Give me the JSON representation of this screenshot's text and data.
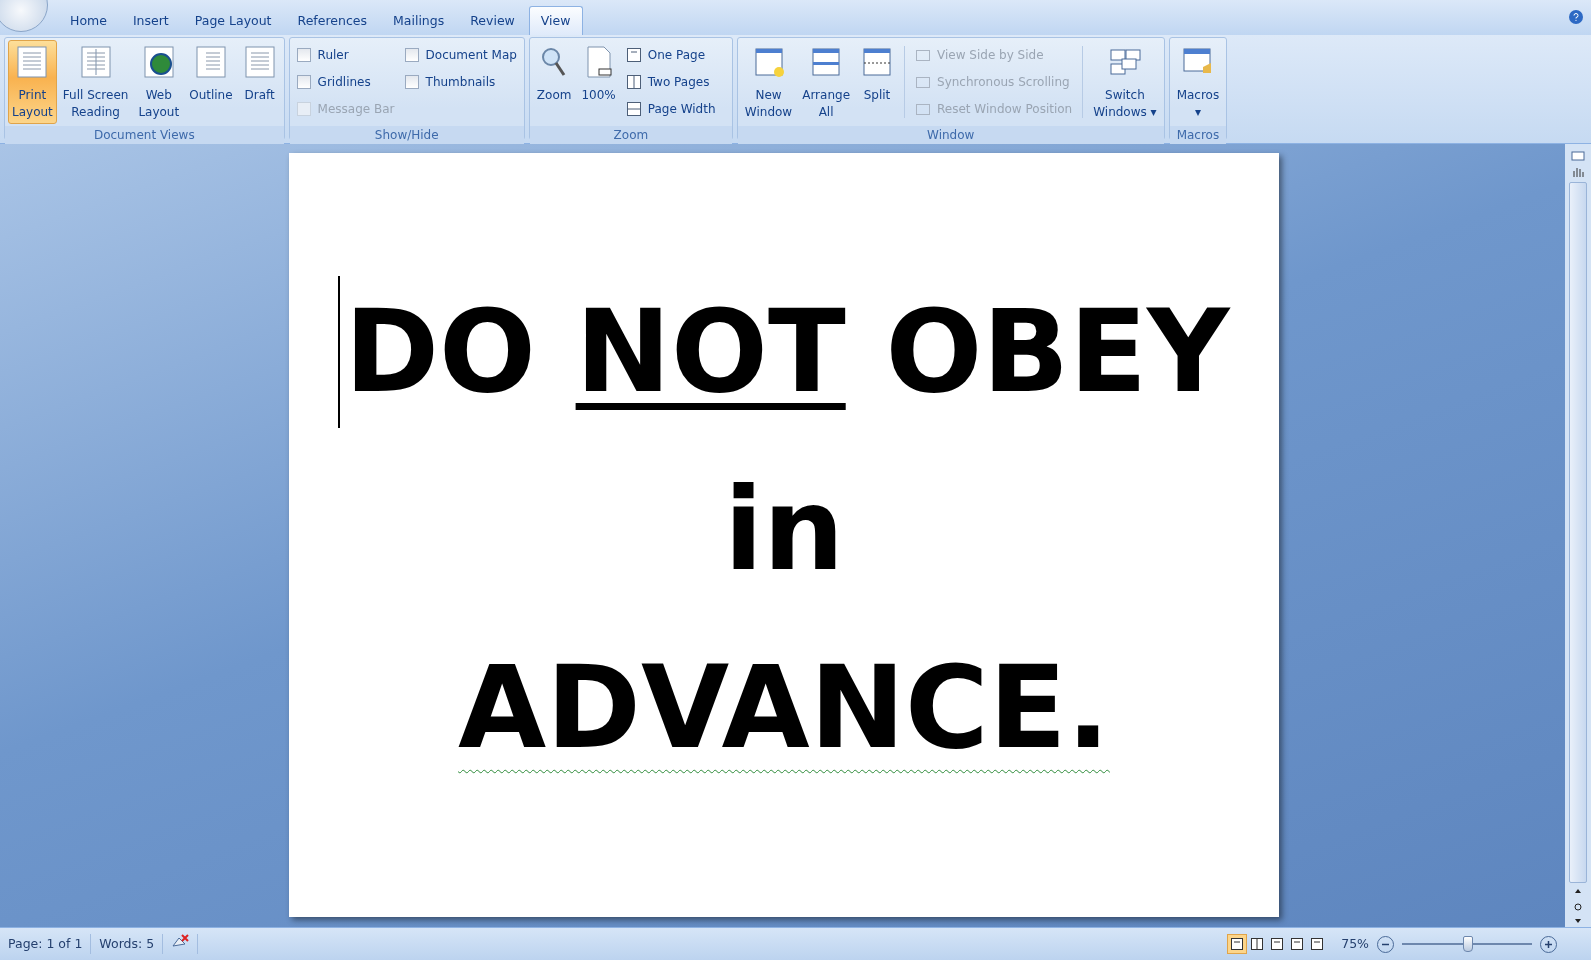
{
  "tabs": [
    {
      "label": "Home",
      "selected": false
    },
    {
      "label": "Insert",
      "selected": false
    },
    {
      "label": "Page Layout",
      "selected": false
    },
    {
      "label": "References",
      "selected": false
    },
    {
      "label": "Mailings",
      "selected": false
    },
    {
      "label": "Review",
      "selected": false
    },
    {
      "label": "View",
      "selected": true
    }
  ],
  "document_views": {
    "label": "Document Views",
    "buttons": [
      {
        "kind": "print",
        "lines": [
          "Print",
          "Layout"
        ],
        "selected": true
      },
      {
        "kind": "fullscreen",
        "lines": [
          "Full Screen",
          "Reading"
        ],
        "selected": false
      },
      {
        "kind": "web",
        "lines": [
          "Web",
          "Layout"
        ],
        "selected": false
      },
      {
        "kind": "outline",
        "lines": [
          "Outline"
        ],
        "selected": false
      },
      {
        "kind": "draft",
        "lines": [
          "Draft"
        ],
        "selected": false
      }
    ]
  },
  "show_hide": {
    "label": "Show/Hide",
    "checkboxes": [
      {
        "label": "Ruler",
        "checked": false,
        "disabled": false
      },
      {
        "label": "Gridlines",
        "checked": false,
        "disabled": false
      },
      {
        "label": "Message Bar",
        "checked": false,
        "disabled": true
      },
      {
        "label": "Document Map",
        "checked": false,
        "disabled": false
      },
      {
        "label": "Thumbnails",
        "checked": false,
        "disabled": false
      }
    ]
  },
  "zoom": {
    "label": "Zoom",
    "buttons": [
      {
        "kind": "zoom",
        "lines": [
          "Zoom"
        ]
      },
      {
        "kind": "hundred",
        "lines": [
          "100%"
        ]
      }
    ],
    "commands": [
      {
        "kind": "one",
        "label": "One Page"
      },
      {
        "kind": "two",
        "label": "Two Pages"
      },
      {
        "kind": "width",
        "label": "Page Width"
      }
    ]
  },
  "window": {
    "label": "Window",
    "buttons": [
      {
        "kind": "new",
        "lines": [
          "New",
          "Window"
        ]
      },
      {
        "kind": "arrange",
        "lines": [
          "Arrange",
          "All"
        ]
      },
      {
        "kind": "split",
        "lines": [
          "Split"
        ]
      }
    ],
    "commands": [
      {
        "label": "View Side by Side",
        "disabled": true
      },
      {
        "label": "Synchronous Scrolling",
        "disabled": true
      },
      {
        "label": "Reset Window Position",
        "disabled": true
      }
    ],
    "switch": {
      "lines": [
        "Switch",
        "Windows"
      ],
      "dropdown": "▾"
    }
  },
  "macros": {
    "label": "Macros",
    "button": "Macros",
    "dropdown": "▾"
  },
  "document": {
    "lines": [
      {
        "segments": [
          {
            "text": "DO ",
            "underline": false
          },
          {
            "text": "NOT",
            "underline": true
          },
          {
            "text": " OBEY",
            "underline": false
          }
        ],
        "grammar_flag": false
      },
      {
        "segments": [
          {
            "text": "in",
            "underline": false
          }
        ],
        "grammar_flag": false
      },
      {
        "segments": [
          {
            "text": "ADVANCE.",
            "underline": false
          }
        ],
        "grammar_flag": true
      }
    ]
  },
  "status_bar": {
    "page": "Page: 1 of 1",
    "words": "Words: 5",
    "views": [
      {
        "kind": "print",
        "selected": true
      },
      {
        "kind": "fullscreen",
        "selected": false
      },
      {
        "kind": "web",
        "selected": false
      },
      {
        "kind": "outline",
        "selected": false
      },
      {
        "kind": "draft",
        "selected": false
      }
    ],
    "zoom": "75%",
    "zoom_level": {
      "level": 0.5
    }
  }
}
